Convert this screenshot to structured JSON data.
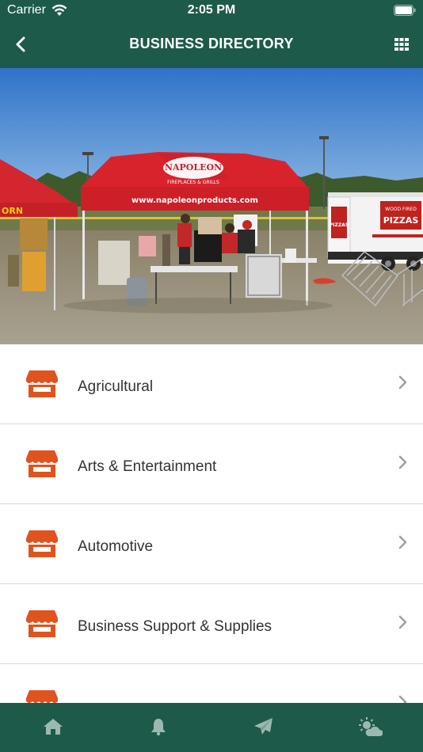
{
  "status_bar": {
    "carrier": "Carrier",
    "time": "2:05 PM"
  },
  "header": {
    "title": "BUSINESS DIRECTORY",
    "back_icon": "chevron-left-icon",
    "menu_icon": "grid-icon"
  },
  "hero": {
    "tent_text": "www.napoleonproducts.com",
    "tent_brand": "NAPOLEON",
    "tent_brand_sub": "FIREPLACES & GRILLS",
    "left_tent_text": "ORN",
    "trailer_text": "PIZZAS",
    "trailer_text_small": "PIZZAS",
    "trailer_brand": "WOOD FIRED"
  },
  "categories": [
    {
      "label": "Agricultural"
    },
    {
      "label": "Arts & Entertainment"
    },
    {
      "label": "Automotive"
    },
    {
      "label": "Business Support & Supplies"
    },
    {
      "label": ""
    }
  ],
  "tabs": [
    {
      "icon": "home-icon"
    },
    {
      "icon": "bell-icon"
    },
    {
      "icon": "paper-plane-icon"
    },
    {
      "icon": "weather-icon"
    }
  ],
  "colors": {
    "primary": "#1d5a4a",
    "accent": "#e0531f",
    "text": "#333333",
    "chevron": "#a0a0a0"
  }
}
